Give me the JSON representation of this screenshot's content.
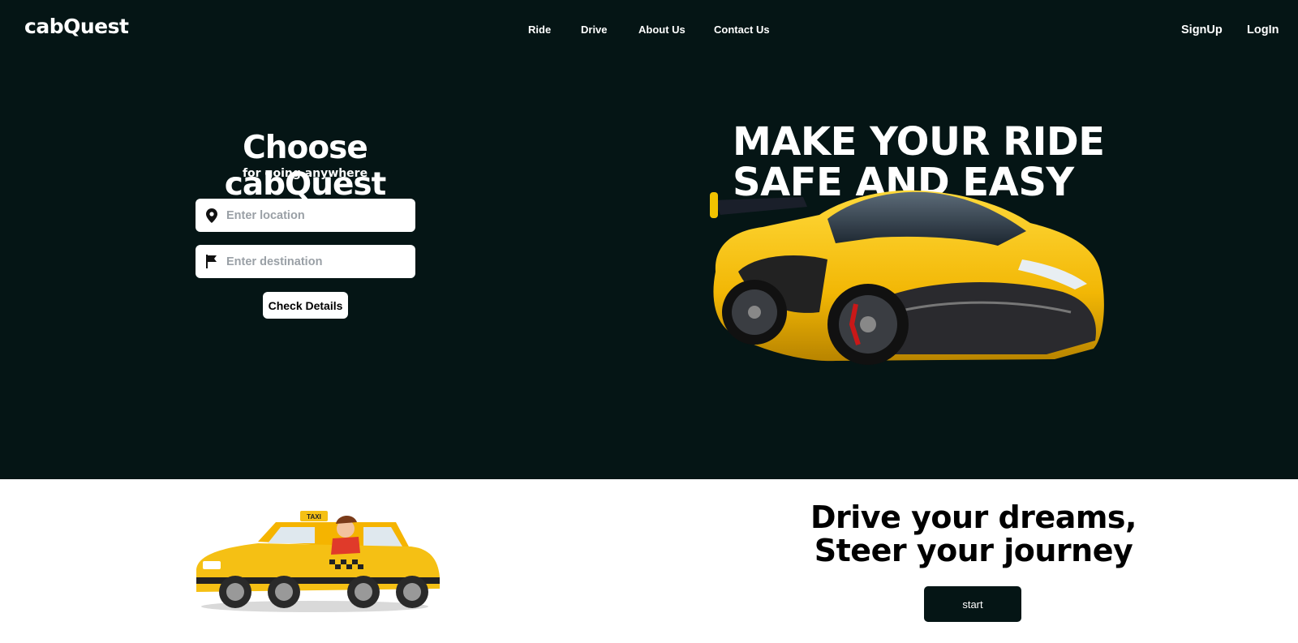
{
  "header": {
    "logo": "cabQuest",
    "nav": [
      "Ride",
      "Drive",
      "About Us",
      "Contact Us"
    ],
    "auth": [
      "SignUp",
      "LogIn"
    ]
  },
  "booking": {
    "title": "Choose cabQuest",
    "subtitle": "for going anywhere",
    "location_placeholder": "Enter location",
    "destination_placeholder": "Enter destination",
    "location_icon": "location-pin-icon",
    "destination_icon": "flag-icon",
    "submit_label": "Check Details"
  },
  "hero": {
    "headline_line1": "MAKE YOUR RIDE",
    "headline_line2": "SAFE AND EASY",
    "image": "yellow-sports-car"
  },
  "drive": {
    "image": "taxi-driver-illustration",
    "taxi_sign": "TAXI",
    "headline_line1": "Drive your dreams,",
    "headline_line2": "Steer your journey",
    "start_label": "start"
  },
  "colors": {
    "hero_bg": "#051515",
    "accent_yellow": "#f5c014",
    "text_light": "#ffffff"
  }
}
